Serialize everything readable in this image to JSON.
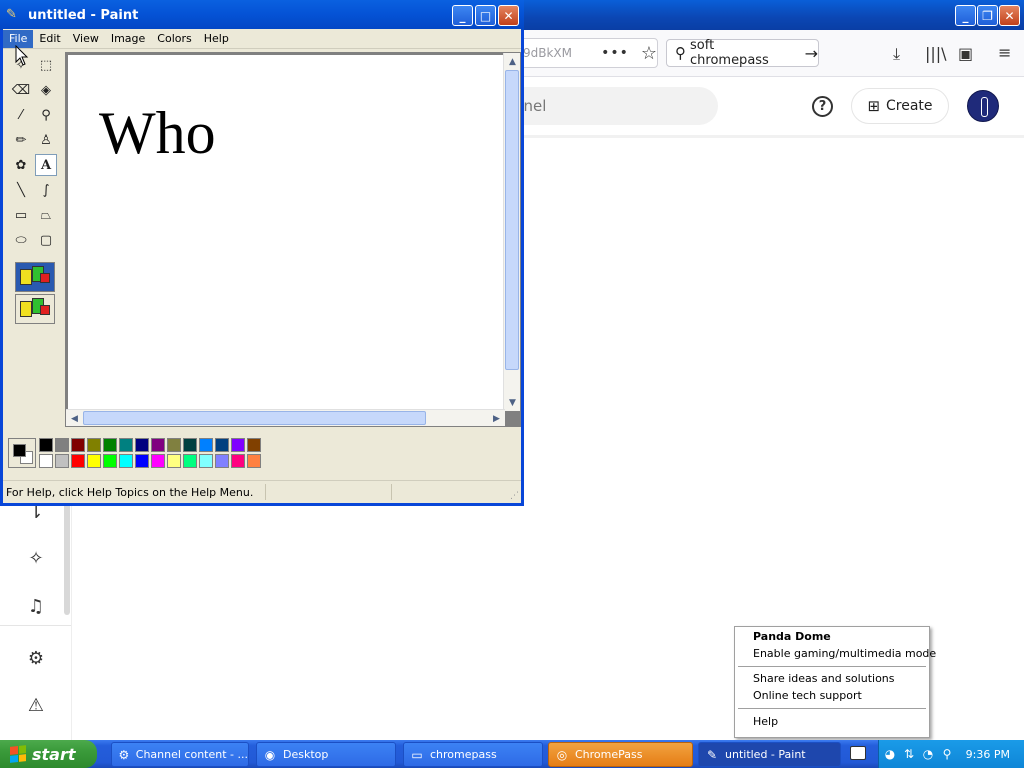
{
  "browser": {
    "url_partial": "9dBkXM",
    "url_menu_icon": "ellipsis-icon",
    "search_text": "soft chromepass",
    "yt_search_placeholder": "nnel",
    "create_label": "Create"
  },
  "paint": {
    "title": "untitled - Paint",
    "menu": [
      "File",
      "Edit",
      "View",
      "Image",
      "Colors",
      "Help"
    ],
    "canvas_text": "Who",
    "status_text": "For Help, click Help Topics on the Help Menu.",
    "text_tool_glyph": "A",
    "palette_top": [
      "#000000",
      "#808080",
      "#800000",
      "#808000",
      "#008000",
      "#008080",
      "#000080",
      "#800080",
      "#808040",
      "#004040",
      "#0080ff",
      "#004080",
      "#8000ff",
      "#804000"
    ],
    "palette_bottom": [
      "#ffffff",
      "#c0c0c0",
      "#ff0000",
      "#ffff00",
      "#00ff00",
      "#00ffff",
      "#0000ff",
      "#ff00ff",
      "#ffff80",
      "#00ff80",
      "#80ffff",
      "#8080ff",
      "#ff0080",
      "#ff8040"
    ]
  },
  "context_menu": {
    "title": "Panda Dome",
    "items": [
      "Enable gaming/multimedia mode",
      "Share ideas and solutions",
      "Online tech support",
      "Help"
    ]
  },
  "taskbar": {
    "start_label": "start",
    "items": [
      "Channel content - ...",
      "Desktop",
      "chromepass",
      "ChromePass",
      "untitled - Paint"
    ],
    "clock": "9:36 PM"
  }
}
